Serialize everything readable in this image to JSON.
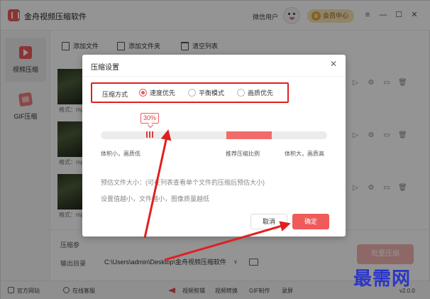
{
  "app": {
    "title": "金舟视频压缩软件",
    "user_label": "微信用户",
    "vip_label": "会员中心",
    "vip_icon": "crown-icon"
  },
  "sidebar": {
    "items": [
      {
        "label": "视频压缩",
        "icon": "video-compress-icon",
        "active": true
      },
      {
        "label": "GIF压缩",
        "icon": "gif-compress-icon",
        "active": false
      }
    ]
  },
  "toolbar": {
    "add_file": "添加文件",
    "add_folder": "添加文件夹",
    "clear_list": "清空列表"
  },
  "files": [
    {
      "format_label": "格式：mp"
    },
    {
      "format_label": "格式：mp"
    },
    {
      "format_label": "格式：mp"
    }
  ],
  "bottom": {
    "param_label": "压缩参",
    "outdir_label": "输出目录",
    "outdir_value": "C:\\Users\\admin\\Desktop\\金舟视频压缩软件",
    "batch_button": "批量压缩"
  },
  "statusbar": {
    "website": "官方网站",
    "support": "在线客服",
    "links": [
      "视频剪辑",
      "视频转换",
      "GIF制作",
      "录屏"
    ],
    "version": "v2.0.0"
  },
  "dialog": {
    "title": "压缩设置",
    "mode_label": "压缩方式",
    "modes": [
      {
        "label": "速度优先",
        "checked": true
      },
      {
        "label": "平衡模式",
        "checked": false
      },
      {
        "label": "画质优先",
        "checked": false
      }
    ],
    "slider_percent_label": "30%",
    "slider_value_percent": 30,
    "hint_left": "体积小，画质低",
    "hint_mid": "推荐压缩比例",
    "hint_right": "体积大，画质高",
    "estimate_label": "预估文件大小：",
    "estimate_note": "(可在列表查看单个文件的压缩后预估大小)",
    "note": "设置值越小，文件越小，图像质量越低",
    "cancel": "取消",
    "ok": "确定"
  },
  "colors": {
    "accent": "#f05a5a",
    "annotation": "#e02020",
    "watermark": "#2b35c8"
  },
  "watermark": "最需网"
}
